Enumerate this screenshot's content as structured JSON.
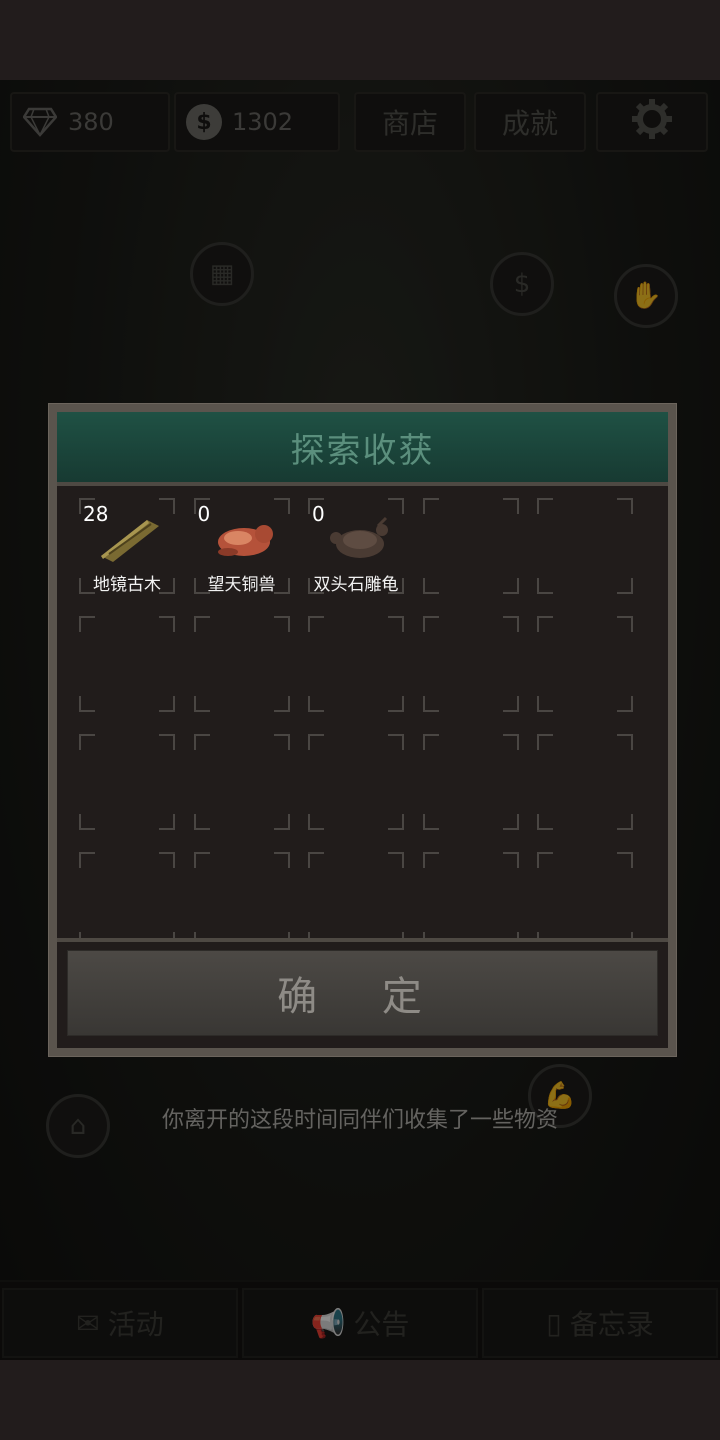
{
  "currency": {
    "gems": "380",
    "coins": "1302"
  },
  "top_buttons": {
    "shop": "商店",
    "achievements": "成就"
  },
  "bottom_buttons": {
    "events": "活动",
    "notice": "公告",
    "memo": "备忘录"
  },
  "dialog": {
    "title": "探索收获",
    "confirm": "确 定",
    "items": [
      {
        "count": "28",
        "name": "地镜古木",
        "icon": "wood-plank-icon"
      },
      {
        "count": "0",
        "name": "望天铜兽",
        "icon": "bronze-beast-icon"
      },
      {
        "count": "0",
        "name": "双头石雕龟",
        "icon": "stone-turtle-icon"
      }
    ]
  },
  "hint": "你离开的这段时间同伴们收集了一些物资",
  "icons": {
    "gem": "diamond-icon",
    "coin": "dollar-coin-icon",
    "settings": "gear-icon"
  },
  "colors": {
    "dialog_header": "#1f5144",
    "title_text": "#5b8f7d",
    "background": "#221c1c"
  }
}
